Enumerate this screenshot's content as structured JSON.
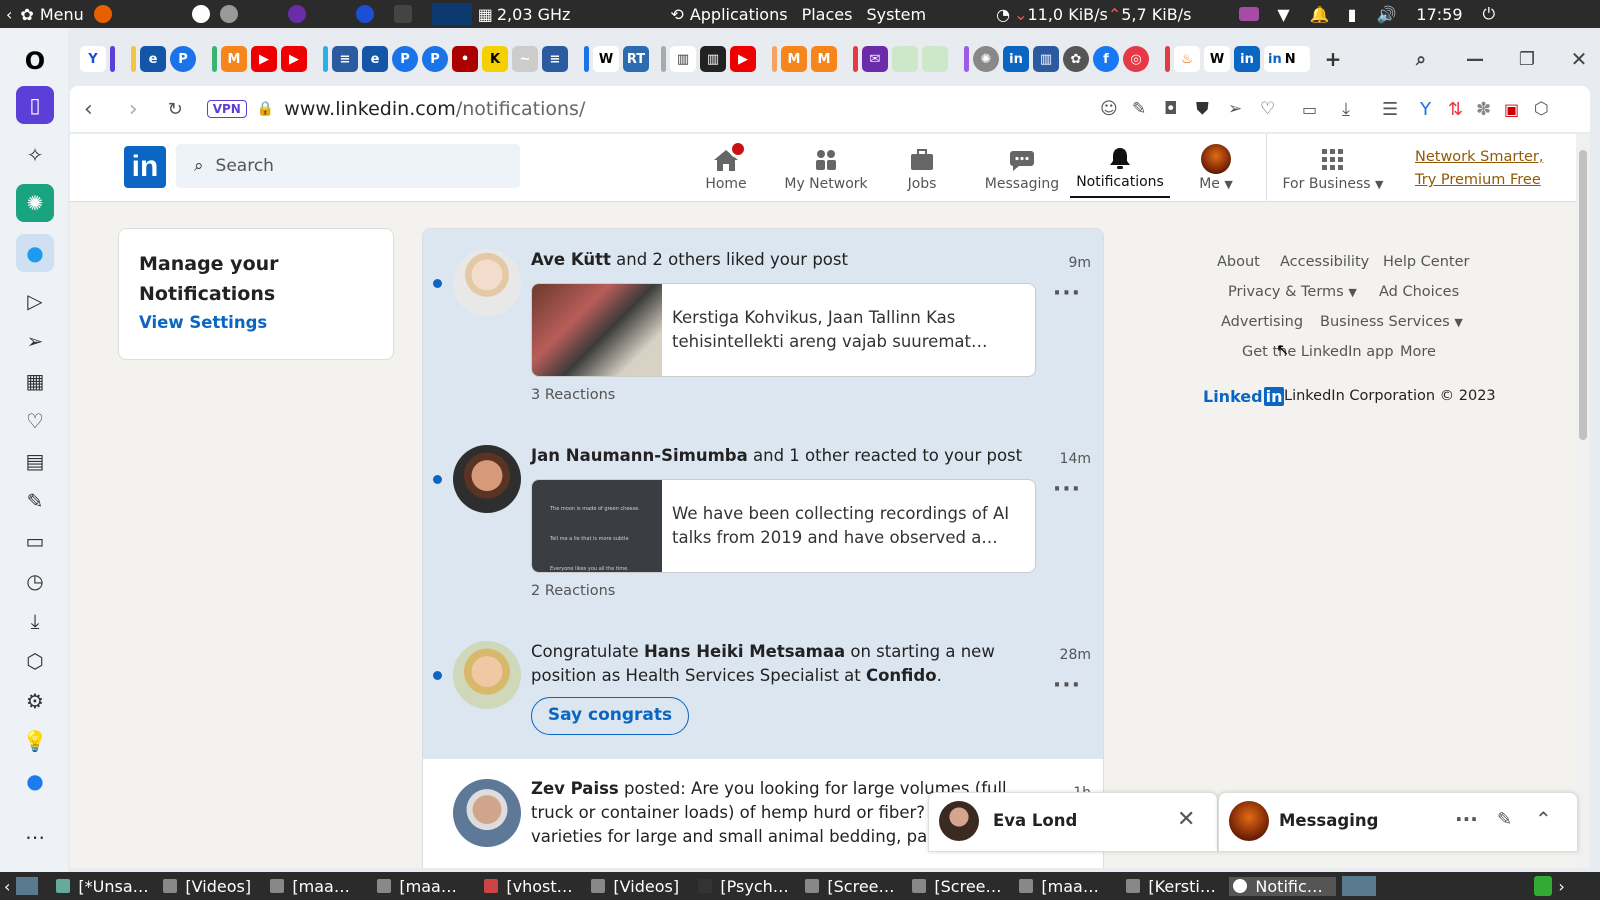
{
  "system_bar": {
    "menu": "Menu",
    "cpu_freq": "2,03 GHz",
    "applications": "Applications",
    "places": "Places",
    "system": "System",
    "net_down": "11,0 KiB/s",
    "net_up": "5,7 KiB/s",
    "clock": "17:59"
  },
  "browser": {
    "vpn_badge": "VPN",
    "url_domain": "www.linkedin.com",
    "url_path": "/notifications/"
  },
  "linkedin": {
    "logo": "in",
    "search_placeholder": "Search",
    "nav": {
      "home": "Home",
      "my_network": "My Network",
      "jobs": "Jobs",
      "messaging": "Messaging",
      "notifications": "Notifications",
      "me": "Me",
      "for_business": "For Business"
    },
    "premium_line1": "Network Smarter,",
    "premium_line2": "Try Premium Free",
    "manage": {
      "title_line1": "Manage your",
      "title_line2": "Notifications",
      "view_settings": "View Settings"
    },
    "notifications": [
      {
        "name": "Ave Kütt",
        "action": " and 2 others liked your post",
        "time": "9m",
        "preview": "Kerstiga Kohvikus, Jaan Tallinn Kas tehisintellekti areng vajab suuremat…",
        "reactions": "3 Reactions"
      },
      {
        "name": "Jan Naumann-Simumba",
        "action": " and 1 other reacted to your post",
        "time": "14m",
        "preview": "We have been collecting recordings of AI talks from 2019 and have observed a…",
        "reactions": "2 Reactions",
        "thumb_lines": [
          "The moon is made of green cheese.",
          "Tell me a lie that is more subtle",
          "Everyone likes you all the time."
        ]
      },
      {
        "prefix": "Congratulate ",
        "name": "Hans Heiki Metsamaa",
        "middle": " on starting a new position as Health Services Specialist at ",
        "company": "Confido",
        "suffix": ".",
        "time": "28m",
        "button": "Say congrats"
      },
      {
        "name": "Zev Paiss",
        "action": " posted: Are you looking for large volumes (full truck or container loads) of hemp hurd or fiber? I have a varieties for large and small animal bedding, pane",
        "time": "1h"
      }
    ],
    "footer": {
      "about": "About",
      "accessibility": "Accessibility",
      "help_center": "Help Center",
      "privacy_terms": "Privacy & Terms",
      "ad_choices": "Ad Choices",
      "advertising": "Advertising",
      "business_services": "Business Services",
      "get_app": "Get the LinkedIn app",
      "more": "More",
      "brand": "Linked",
      "brand_in": "in",
      "copyright": "LinkedIn Corporation © 2023"
    },
    "chat_popup": {
      "name": "Eva Lond"
    },
    "messaging_popup": {
      "title": "Messaging"
    }
  },
  "taskbar": {
    "items": [
      "[*Unsa…",
      "[Videos]",
      "[maa…",
      "[maa…",
      "[vhost…",
      "[Videos]",
      "[Psych…",
      "[Scree…",
      "[Scree…",
      "[maa…",
      "[Kersti…",
      "Notific…"
    ]
  },
  "colors": {
    "linkedin_blue": "#0a66c2",
    "notif_bg": "#dce6f1",
    "premium": "#915907"
  }
}
